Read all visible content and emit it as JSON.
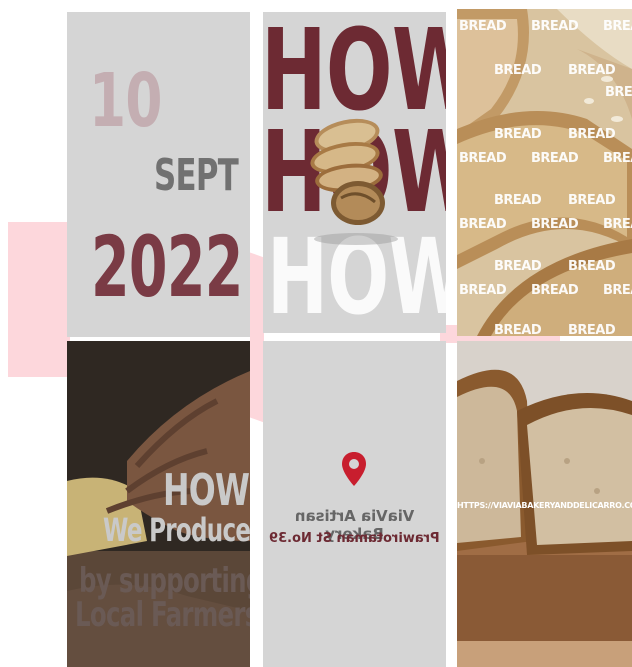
{
  "colors": {
    "pink_shape": "#fdd7dc",
    "maroon": "#6d2a33",
    "grey_tile": "#d5d5d5",
    "pin_red": "#c81e2e"
  },
  "tile_date": {
    "day": "10",
    "month": "SEPT",
    "year": "2022"
  },
  "tile_how": {
    "line1": "HOW",
    "line2": "HOW",
    "line3": "HOW"
  },
  "tile_bread": {
    "word": "BREAD"
  },
  "tile_produce": {
    "line1": "HOW",
    "line2": "We Produce",
    "line3": "by supporting",
    "line4": "Local Farmers"
  },
  "tile_location": {
    "icon": "location-pin-icon",
    "name": "ViaVia Artisan Bakery",
    "address": "Prawirotaman St No.39"
  },
  "tile_loaf": {
    "url": "HTTPS://VIAVIABAKERYANDDELICARRO.CO/"
  }
}
